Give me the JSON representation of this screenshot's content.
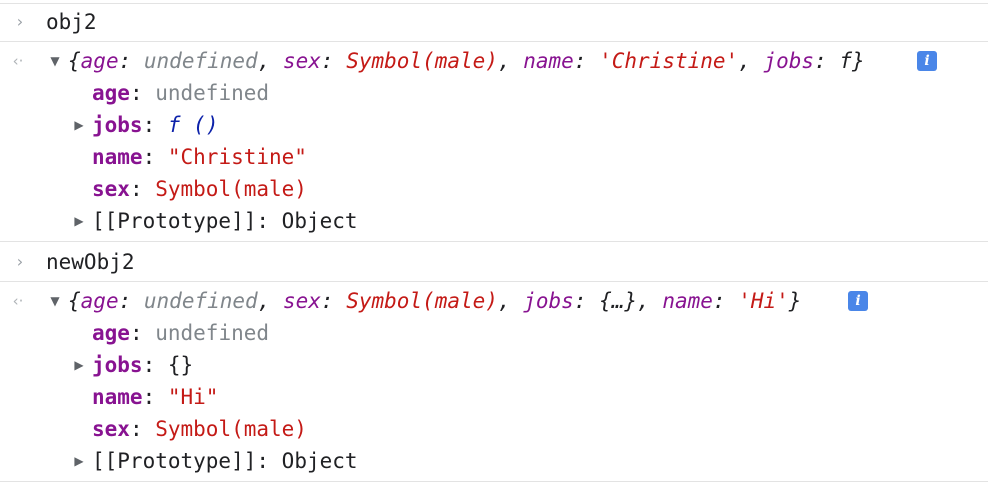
{
  "entries": [
    {
      "input": "obj2",
      "preview": {
        "open": "{",
        "age_key": "age",
        "age_val": "undefined",
        "sex_key": "sex",
        "sex_val": "Symbol(male)",
        "third_key": "name",
        "third_val": "'Christine'",
        "fourth_key": "jobs",
        "fourth_val": "f",
        "close": "}"
      },
      "props": {
        "age": {
          "key": "age",
          "value": "undefined"
        },
        "jobs": {
          "key": "jobs",
          "value_f": "f",
          "value_rest": " ()"
        },
        "name": {
          "key": "name",
          "value": "\"Christine\""
        },
        "sex": {
          "key": "sex",
          "value": "Symbol(male)"
        },
        "prototype": {
          "key": "[[Prototype]]",
          "value": "Object"
        }
      }
    },
    {
      "input": "newObj2",
      "preview": {
        "open": "{",
        "age_key": "age",
        "age_val": "undefined",
        "sex_key": "sex",
        "sex_val": "Symbol(male)",
        "third_key": "jobs",
        "third_val": "{…}",
        "fourth_key": "name",
        "fourth_val": "'Hi'",
        "close": "}"
      },
      "props": {
        "age": {
          "key": "age",
          "value": "undefined"
        },
        "jobs": {
          "key": "jobs",
          "value": "{}"
        },
        "name": {
          "key": "name",
          "value": "\"Hi\""
        },
        "sex": {
          "key": "sex",
          "value": "Symbol(male)"
        },
        "prototype": {
          "key": "[[Prototype]]",
          "value": "Object"
        }
      }
    }
  ],
  "glyphs": {
    "prompt": "›",
    "result": "‹·",
    "expanded": "▼",
    "collapsed": "▶",
    "info": "i"
  },
  "punct": {
    "colon": ": ",
    "comma": ", "
  },
  "colors": {
    "property_key": "#881391",
    "string_value": "#c41a16",
    "muted_value": "#80868b",
    "function_value": "#0d22aa",
    "info_badge": "#4a86e8"
  }
}
